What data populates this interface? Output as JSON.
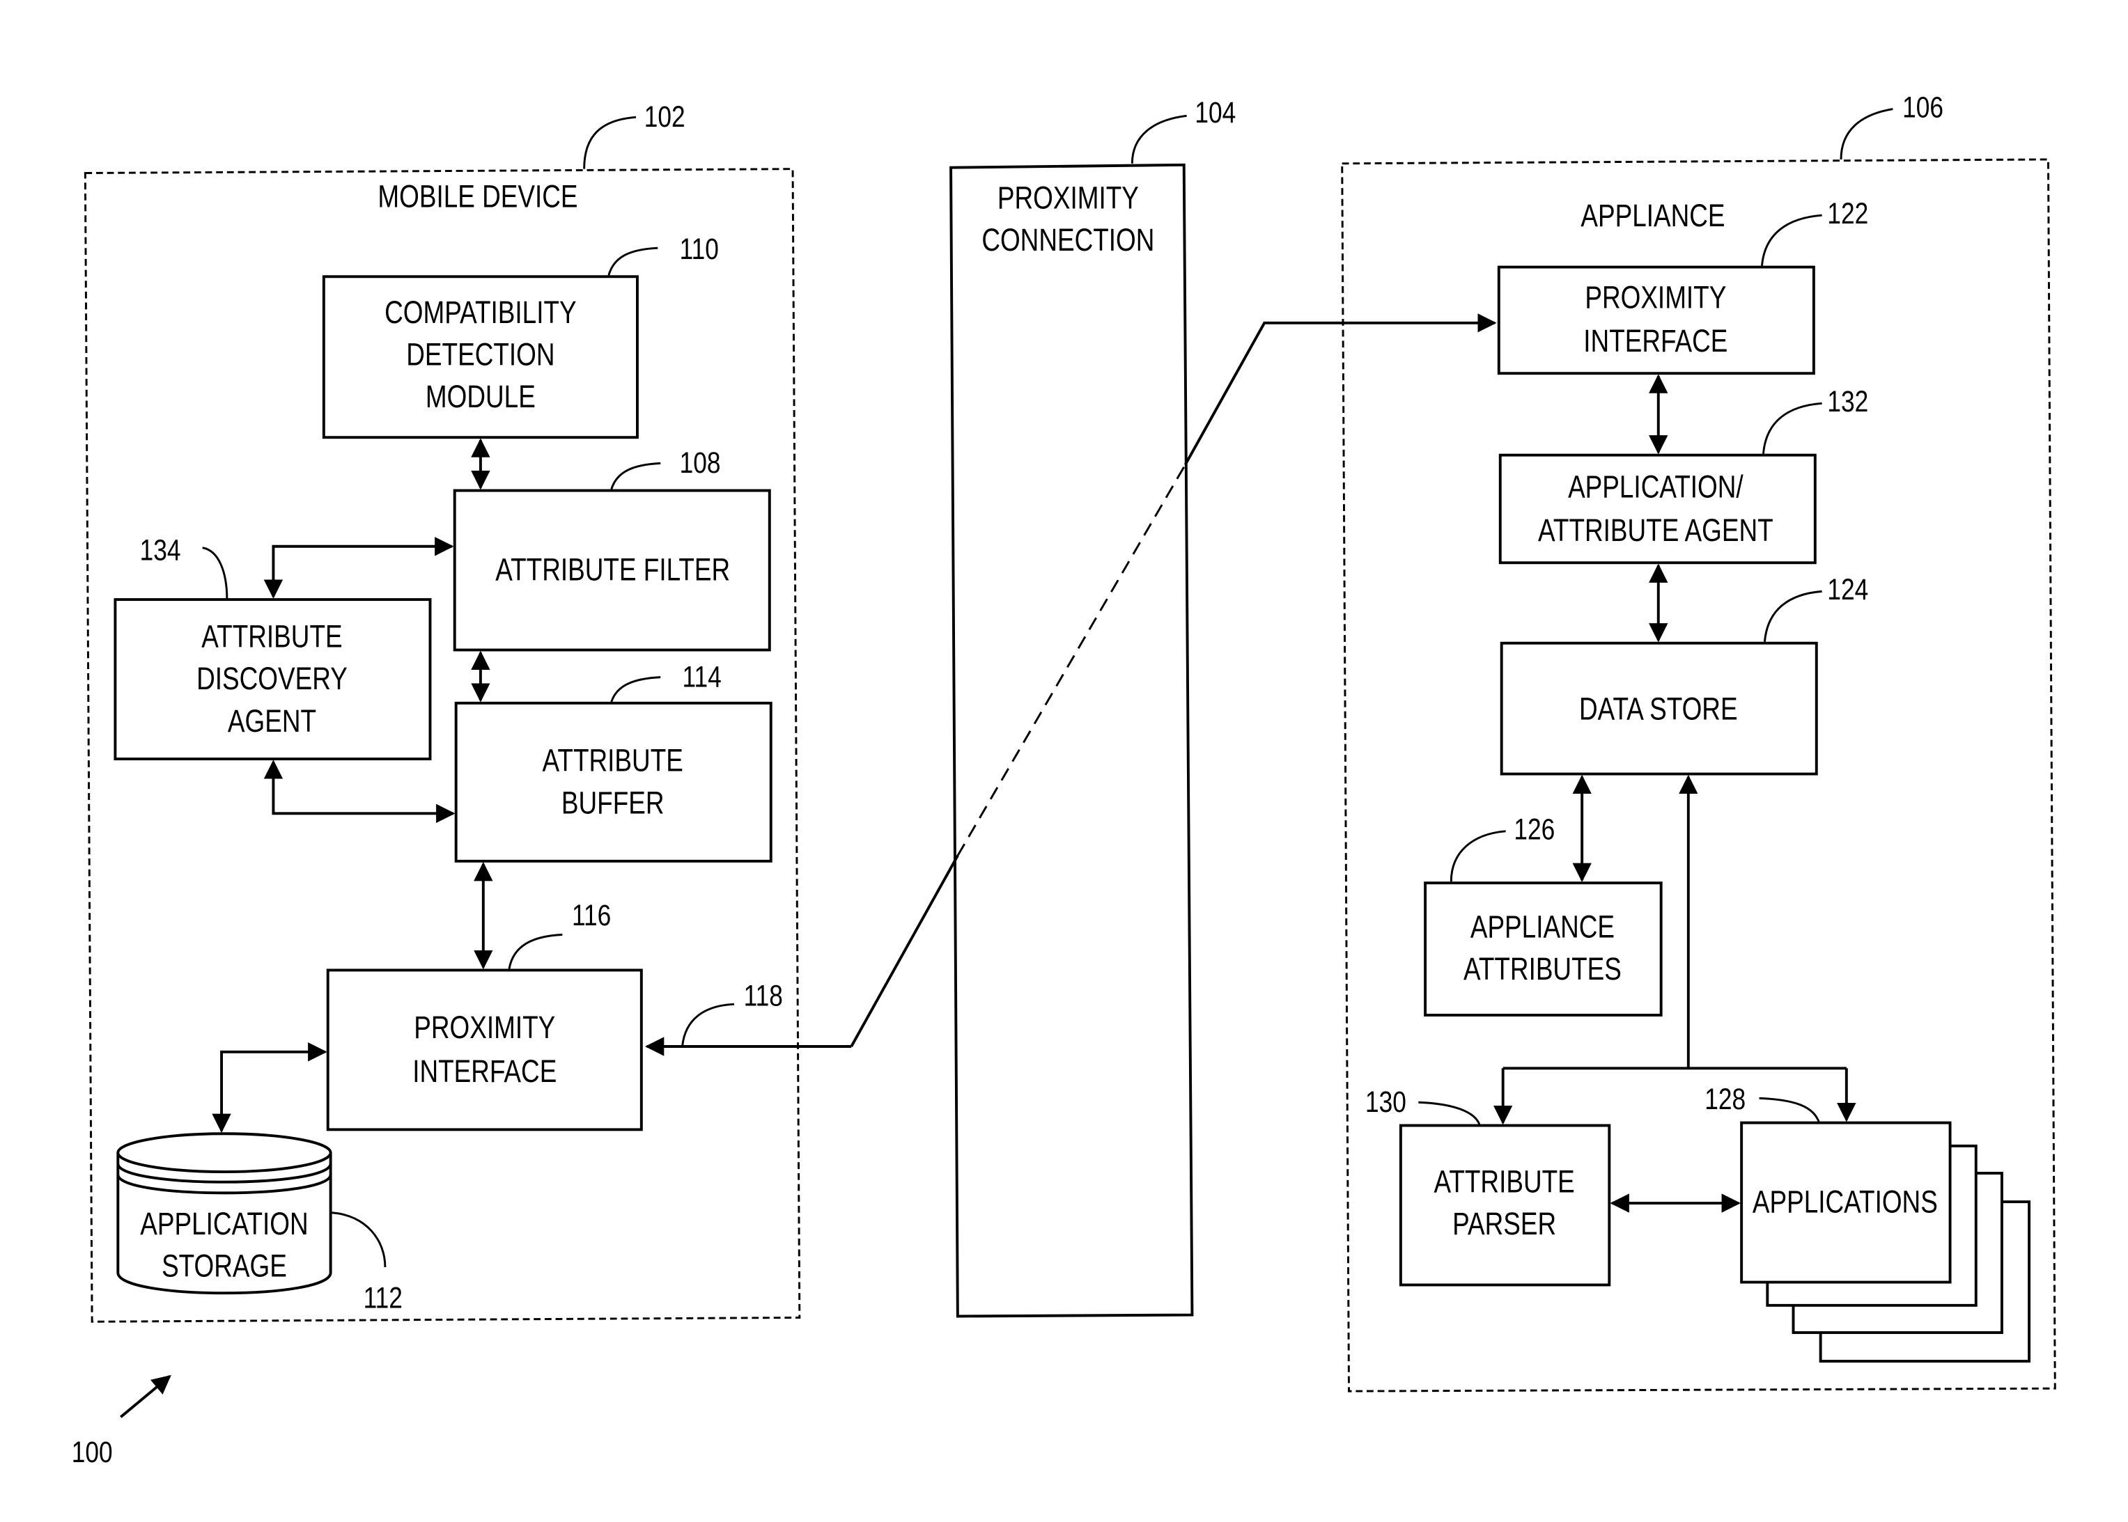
{
  "figure_number": "100",
  "mobile_device": {
    "ref": "102",
    "title": "MOBILE DEVICE",
    "compatibility_detection_module": {
      "ref": "110",
      "lines": [
        "COMPATIBILITY",
        "DETECTION",
        "MODULE"
      ]
    },
    "attribute_filter": {
      "ref": "108",
      "lines": [
        "ATTRIBUTE FILTER"
      ]
    },
    "attribute_discovery_agent": {
      "ref": "134",
      "lines": [
        "ATTRIBUTE",
        "DISCOVERY",
        "AGENT"
      ]
    },
    "attribute_buffer": {
      "ref": "114",
      "lines": [
        "ATTRIBUTE",
        "BUFFER"
      ]
    },
    "proximity_interface": {
      "ref": "116",
      "lines": [
        "PROXIMITY",
        "INTERFACE"
      ]
    },
    "application_storage": {
      "ref": "112",
      "lines": [
        "APPLICATION",
        "STORAGE"
      ]
    },
    "link_ref": "118"
  },
  "proximity_connection": {
    "ref": "104",
    "lines": [
      "PROXIMITY",
      "CONNECTION"
    ]
  },
  "appliance": {
    "ref": "106",
    "title": "APPLIANCE",
    "proximity_interface": {
      "ref": "122",
      "lines": [
        "PROXIMITY",
        "INTERFACE"
      ]
    },
    "application_attribute_agent": {
      "ref": "132",
      "lines": [
        "APPLICATION/",
        "ATTRIBUTE AGENT"
      ]
    },
    "data_store": {
      "ref": "124",
      "lines": [
        "DATA STORE"
      ]
    },
    "appliance_attributes": {
      "ref": "126",
      "lines": [
        "APPLIANCE",
        "ATTRIBUTES"
      ]
    },
    "attribute_parser": {
      "ref": "130",
      "lines": [
        "ATTRIBUTE",
        "PARSER"
      ]
    },
    "applications": {
      "ref": "128",
      "lines": [
        "APPLICATIONS"
      ]
    }
  }
}
